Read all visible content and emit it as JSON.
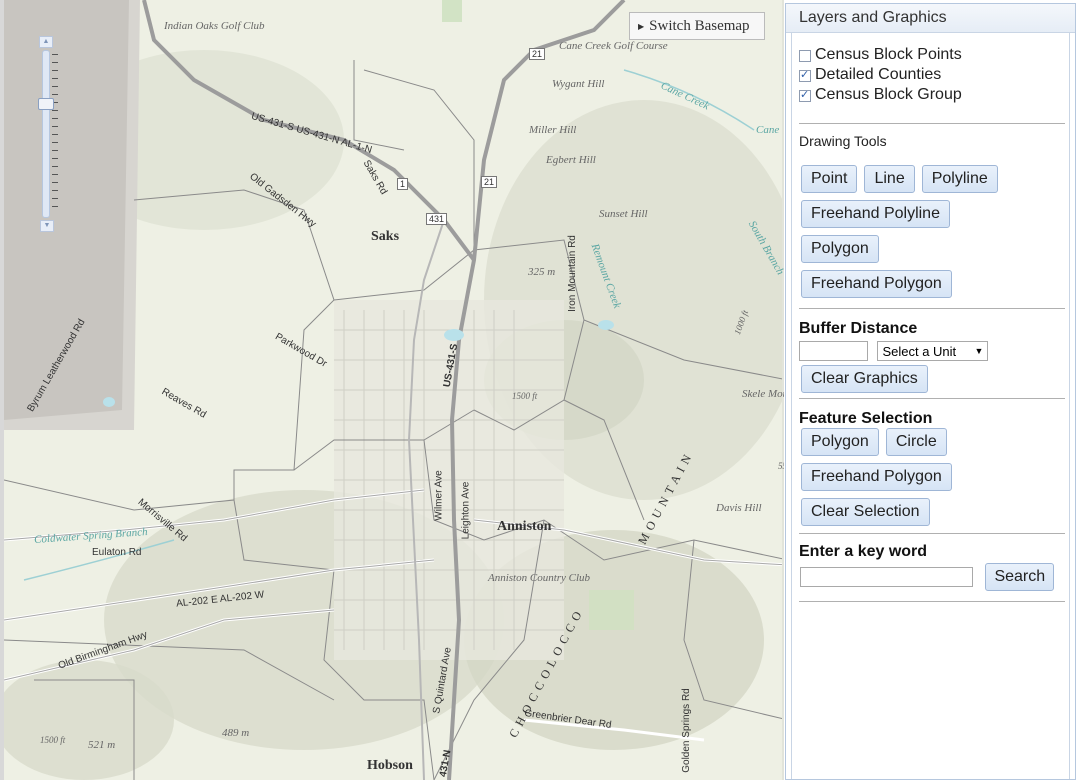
{
  "map": {
    "switch_basemap_label": "Switch Basemap",
    "labels": {
      "indian_oaks": "Indian Oaks Golf Club",
      "cane_creek_gc": "Cane Creek Golf Course",
      "wygant": "Wygant Hill",
      "cane_creek": "Cane Creek",
      "cane_creek2": "Cane",
      "miller": "Miller Hill",
      "egbert": "Egbert Hill",
      "us431": "US-431-S US-431-N AL-1-N",
      "old_gadsden": "Old Gadsden Hwy",
      "saks_rd": "Saks Rd",
      "saks": "Saks",
      "sunset": "Sunset Hill",
      "elev325": "325 m",
      "iron_mountain": "Iron Mountain Rd",
      "remount": "Remount Creek",
      "south_branch": "South Branch",
      "parkwood": "Parkwood Dr",
      "byrum": "Byrum Leatherwood Rd",
      "reaves": "Reaves Rd",
      "us431s": "US-431-S",
      "skeleton": "Skele Moun",
      "morrisville": "Morrisville Rd",
      "coldwater": "Coldwater Spring Branch",
      "wilmer": "Wilmer Ave",
      "leighton": "Leighton Ave",
      "anniston": "Anniston",
      "davis": "Davis Hill",
      "eulaton": "Eulaton Rd",
      "anniston_cc": "Anniston Country Club",
      "al202": "AL-202 E AL-202 W",
      "old_birmingham": "Old Birmingham Hwy",
      "mountain": "MOUNTAIN",
      "choccolocco": "CHOCCOLOCCO",
      "s_quintard": "S Quintard Ave",
      "greenbrier": "Greenbrier Dear Rd",
      "golden_springs": "Golden Springs Rd",
      "elev1500": "1500 ft",
      "elev521": "521 m",
      "elev489": "489 m",
      "hobson": "Hobson",
      "shield21a": "21",
      "shield21b": "21",
      "shield1": "1",
      "shield431": "431",
      "elev1000": "1000 ft",
      "elev1500b": "1500 ft",
      "s431n": "431-N",
      "num55": "55"
    }
  },
  "panel": {
    "title": "Layers and Graphics",
    "layers": [
      {
        "label": "Census Block Points",
        "checked": false
      },
      {
        "label": "Detailed Counties",
        "checked": true
      },
      {
        "label": "Census Block Group",
        "checked": true
      }
    ],
    "drawing_tools": {
      "heading": "Drawing Tools",
      "buttons": [
        "Point",
        "Line",
        "Polyline",
        "Freehand Polyline",
        "Polygon",
        "Freehand Polygon"
      ]
    },
    "buffer": {
      "heading": "Buffer Distance",
      "input_value": "",
      "select_value": "Select a Unit",
      "clear_label": "Clear Graphics"
    },
    "feature_selection": {
      "heading": "Feature Selection",
      "buttons": [
        "Polygon",
        "Circle",
        "Freehand Polygon",
        "Clear Selection"
      ]
    },
    "keyword": {
      "heading": "Enter a key word",
      "input_value": "",
      "search_label": "Search"
    }
  },
  "colors": {
    "map_background": "#eef0e4",
    "button_gradient_top": "#e9f1fb",
    "button_border": "#9fb6d6",
    "panel_border": "#b5c7de"
  }
}
